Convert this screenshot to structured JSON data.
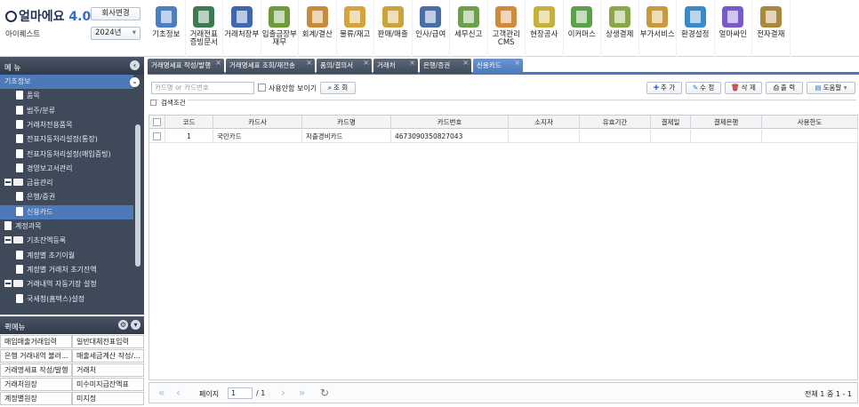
{
  "header": {
    "logo_text": "얼마에요",
    "logo_version": "4.0",
    "company_change_label": "회사변경",
    "company_name": "아이퀘스트",
    "year": "2024년"
  },
  "topmenu": [
    {
      "label": "기초정보",
      "icon": "basic-info-icon",
      "color": "#4a7fc1"
    },
    {
      "label": "거래전표\n증빙문서",
      "icon": "voucher-icon",
      "color": "#3d7a52"
    },
    {
      "label": "거래처장부",
      "icon": "ledger-icon",
      "color": "#3f66b0"
    },
    {
      "label": "입출금장부\n재무",
      "icon": "money-bag-icon",
      "color": "#6e9a3a"
    },
    {
      "label": "회계/결산",
      "icon": "accounting-icon",
      "color": "#c98b3a"
    },
    {
      "label": "물류/재고",
      "icon": "forklift-icon",
      "color": "#d6a23a"
    },
    {
      "label": "판매/매출",
      "icon": "sales-icon",
      "color": "#c9a43a"
    },
    {
      "label": "인사/급여",
      "icon": "person-icon",
      "color": "#4a6ea8"
    },
    {
      "label": "세무신고",
      "icon": "tax-icon",
      "color": "#6ba04a"
    },
    {
      "label": "고객관리\nCMS",
      "icon": "customer-icon",
      "color": "#d08a3a"
    },
    {
      "label": "현장공사",
      "icon": "construction-icon",
      "color": "#c8b13a"
    },
    {
      "label": "이커머스",
      "icon": "ecommerce-icon",
      "color": "#5ca04a"
    },
    {
      "label": "상생결제",
      "icon": "payment-icon",
      "color": "#8aa84a"
    },
    {
      "label": "부가서비스",
      "icon": "bank-icon",
      "color": "#c99a3a"
    },
    {
      "label": "환경설정",
      "icon": "gear-icon",
      "color": "#3a8ac9"
    },
    {
      "label": "얼마싸인",
      "icon": "signature-icon",
      "color": "#7a5ac9"
    },
    {
      "label": "전자결재",
      "icon": "approval-icon",
      "color": "#a8883a"
    }
  ],
  "sidebar": {
    "title": "메 뉴",
    "tree": [
      {
        "label": "기초정보",
        "level": 0,
        "type": "category"
      },
      {
        "label": "품목",
        "level": 1,
        "type": "doc"
      },
      {
        "label": "범주/분류",
        "level": 1,
        "type": "doc"
      },
      {
        "label": "거래처전용품목",
        "level": 1,
        "type": "doc"
      },
      {
        "label": "전표자동처리설정(통장)",
        "level": 1,
        "type": "doc"
      },
      {
        "label": "전표자동처리설정(매입증빙)",
        "level": 1,
        "type": "doc"
      },
      {
        "label": "경영보고서관리",
        "level": 1,
        "type": "doc"
      },
      {
        "label": "금융관리",
        "level": 0,
        "type": "folder"
      },
      {
        "label": "은행/증권",
        "level": 1,
        "type": "doc"
      },
      {
        "label": "신용카드",
        "level": 1,
        "type": "doc",
        "selected": true
      },
      {
        "label": "계정과목",
        "level": 0,
        "type": "doc"
      },
      {
        "label": "기초잔액등록",
        "level": 0,
        "type": "folder"
      },
      {
        "label": "계정별 초기이월",
        "level": 1,
        "type": "doc"
      },
      {
        "label": "계정별 거래처 초기잔액",
        "level": 1,
        "type": "doc"
      },
      {
        "label": "거래내역 자동기장 설정",
        "level": 0,
        "type": "folder"
      },
      {
        "label": "국세청(홈택스)설정",
        "level": 1,
        "type": "doc"
      }
    ]
  },
  "quickmenu": {
    "title": "퀵메뉴",
    "items": [
      [
        "매입매출거래입력",
        "일반대체전표입력"
      ],
      [
        "은행 거래내역 불러...",
        "매출세금계산 작성/..."
      ],
      [
        "거래명세표 작성/발행",
        "거래처"
      ],
      [
        "거래처원장",
        "미수미지급잔액표"
      ],
      [
        "계정별원장",
        "미지정"
      ]
    ]
  },
  "tabs": [
    {
      "label": "거래명세표 작성/발행"
    },
    {
      "label": "거래명세표 조회/재전송"
    },
    {
      "label": "품의/결의서"
    },
    {
      "label": "거래처"
    },
    {
      "label": "은행/증권"
    },
    {
      "label": "신용카드",
      "active": true
    }
  ],
  "toolbar": {
    "search_placeholder": "카드명 or 카드번호",
    "show_unused_label": "사용안함 보이기",
    "search_button": "조 회",
    "add_button": "추 가",
    "edit_button": "수 정",
    "delete_button": "삭 제",
    "print_button": "출 력",
    "help_button": "도움말",
    "search_conditions_label": "검색조건"
  },
  "table": {
    "columns": [
      "코드",
      "카드사",
      "카드명",
      "카드번호",
      "소지자",
      "유효기간",
      "결제일",
      "결제은행",
      "사용한도"
    ],
    "rows": [
      [
        "1",
        "국민카드",
        "지출경비카드",
        "4673090350827043",
        "",
        "",
        "",
        "",
        ""
      ]
    ]
  },
  "pager": {
    "page_label": "페이지",
    "page_value": "1",
    "total_pages": "/ 1",
    "summary": "전체 1 중 1 - 1"
  }
}
